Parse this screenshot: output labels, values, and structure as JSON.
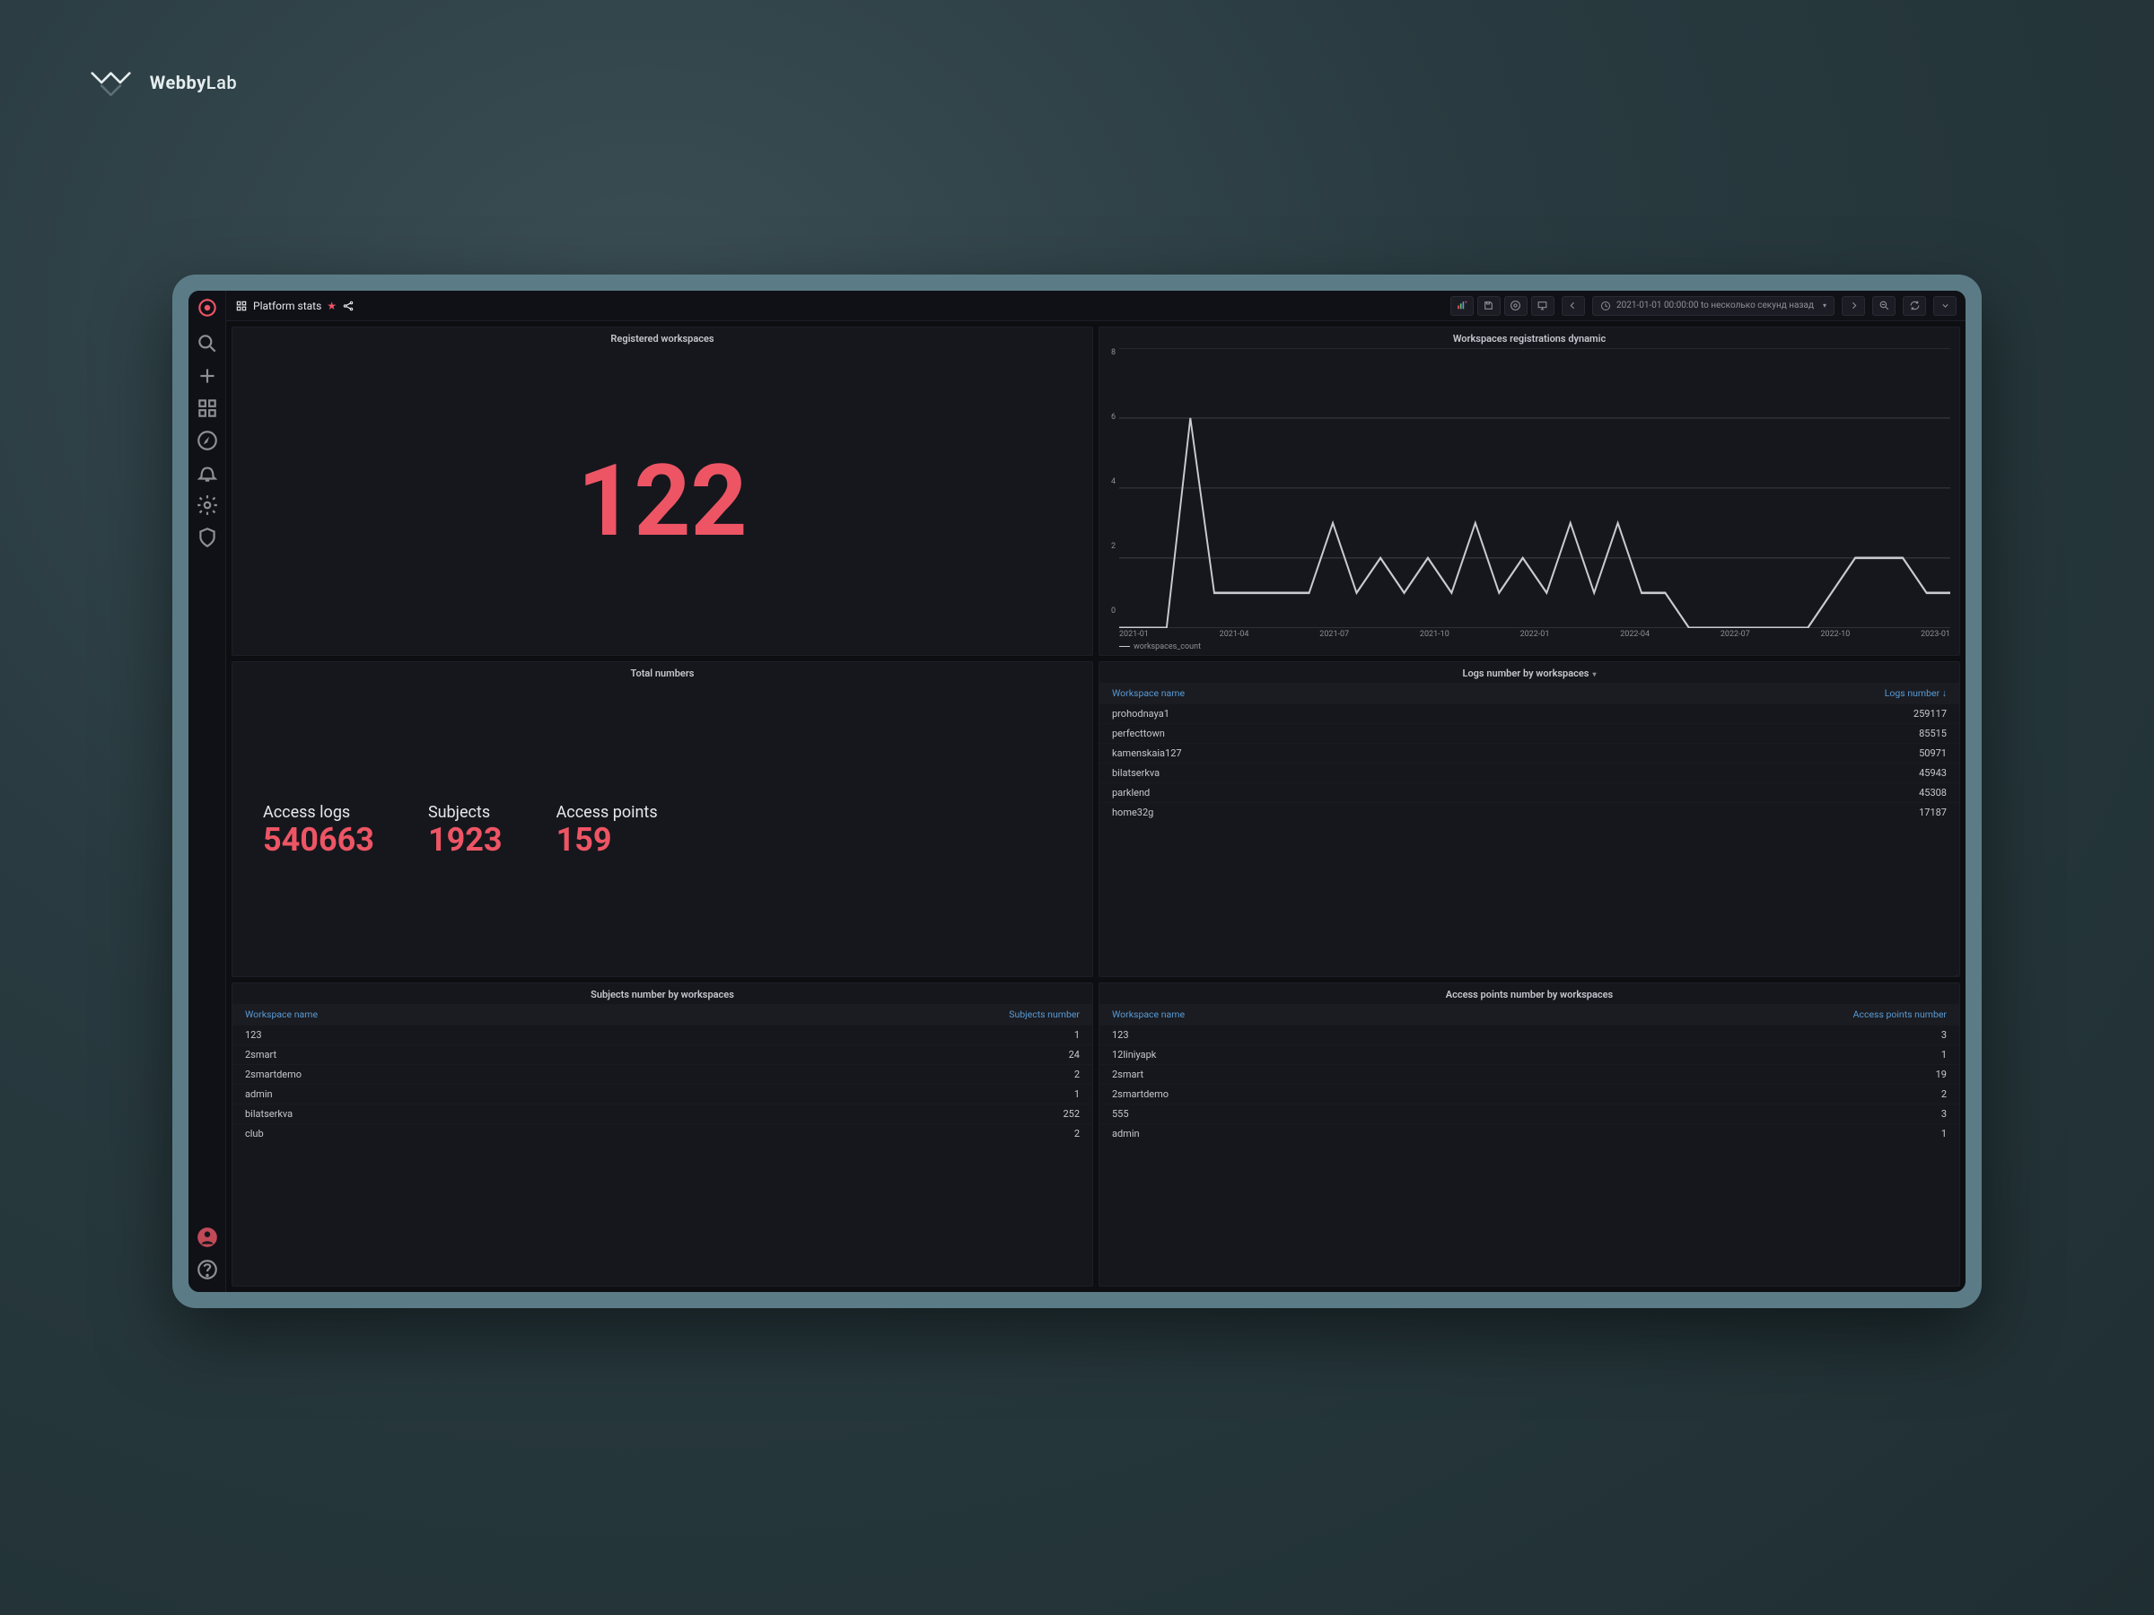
{
  "brand": {
    "name": "WebbyLab"
  },
  "topbar": {
    "title": "Platform stats",
    "time_range": "2021-01-01 00:00:00 to несколько секунд назад"
  },
  "sidebar": {
    "logo": "grafana-logo",
    "nav_icons": [
      "search-icon",
      "plus-icon",
      "dashboards-icon",
      "explore-icon",
      "bell-icon",
      "gear-icon",
      "shield-icon"
    ],
    "foot_icons": [
      "avatar-icon",
      "help-icon"
    ]
  },
  "panels": {
    "registered_workspaces": {
      "title": "Registered workspaces",
      "value": "122"
    },
    "registrations_dynamic": {
      "title": "Workspaces registrations dynamic",
      "legend": "workspaces_count"
    },
    "total_numbers": {
      "title": "Total numbers",
      "items": [
        {
          "label": "Access logs",
          "value": "540663"
        },
        {
          "label": "Subjects",
          "value": "1923"
        },
        {
          "label": "Access points",
          "value": "159"
        }
      ]
    },
    "logs_by_ws": {
      "title": "Logs number by workspaces",
      "col1": "Workspace name",
      "col2": "Logs number",
      "sort_indicator": "↓",
      "rows": [
        {
          "name": "prohodnaya1",
          "val": "259117"
        },
        {
          "name": "perfecttown",
          "val": "85515"
        },
        {
          "name": "kamenskaia127",
          "val": "50971"
        },
        {
          "name": "bilatserkva",
          "val": "45943"
        },
        {
          "name": "parklend",
          "val": "45308"
        },
        {
          "name": "home32g",
          "val": "17187"
        }
      ]
    },
    "subjects_by_ws": {
      "title": "Subjects number by workspaces",
      "col1": "Workspace name",
      "col2": "Subjects number",
      "rows": [
        {
          "name": "123",
          "val": "1"
        },
        {
          "name": "2smart",
          "val": "24"
        },
        {
          "name": "2smartdemo",
          "val": "2"
        },
        {
          "name": "admin",
          "val": "1"
        },
        {
          "name": "bilatserkva",
          "val": "252"
        },
        {
          "name": "club",
          "val": "2"
        }
      ]
    },
    "ap_by_ws": {
      "title": "Access points number by workspaces",
      "col1": "Workspace name",
      "col2": "Access points number",
      "rows": [
        {
          "name": "123",
          "val": "3"
        },
        {
          "name": "12liniyapk",
          "val": "1"
        },
        {
          "name": "2smart",
          "val": "19"
        },
        {
          "name": "2smartdemo",
          "val": "2"
        },
        {
          "name": "555",
          "val": "3"
        },
        {
          "name": "admin",
          "val": "1"
        }
      ]
    }
  },
  "chart_data": {
    "type": "line",
    "title": "Workspaces registrations dynamic",
    "xlabel": "",
    "ylabel": "",
    "ylim": [
      0,
      8
    ],
    "y_ticks": [
      0,
      2,
      4,
      6,
      8
    ],
    "x_ticks": [
      "2021-01",
      "2021-04",
      "2021-07",
      "2021-10",
      "2022-01",
      "2022-04",
      "2022-07",
      "2022-10",
      "2023-01"
    ],
    "series": [
      {
        "name": "workspaces_count",
        "x": [
          "2021-01",
          "2021-02",
          "2021-03",
          "2021-04",
          "2021-04b",
          "2021-05",
          "2021-06",
          "2021-07",
          "2021-08",
          "2021-08b",
          "2021-09",
          "2021-09b",
          "2021-10",
          "2021-10b",
          "2021-11",
          "2021-11b",
          "2021-11c",
          "2021-12",
          "2021-12b",
          "2022-01",
          "2022-01b",
          "2022-02",
          "2022-02b",
          "2022-03",
          "2022-04",
          "2022-05",
          "2022-06",
          "2022-07",
          "2022-08",
          "2022-09",
          "2022-10",
          "2022-11",
          "2022-12",
          "2023-01",
          "2023-02",
          "2023-03"
        ],
        "values": [
          0,
          0,
          0,
          6,
          1,
          1,
          1,
          1,
          1,
          3,
          1,
          2,
          1,
          2,
          1,
          3,
          1,
          2,
          1,
          3,
          1,
          3,
          1,
          1,
          0,
          0,
          0,
          0,
          0,
          0,
          1,
          2,
          2,
          2,
          1,
          1
        ]
      }
    ]
  }
}
